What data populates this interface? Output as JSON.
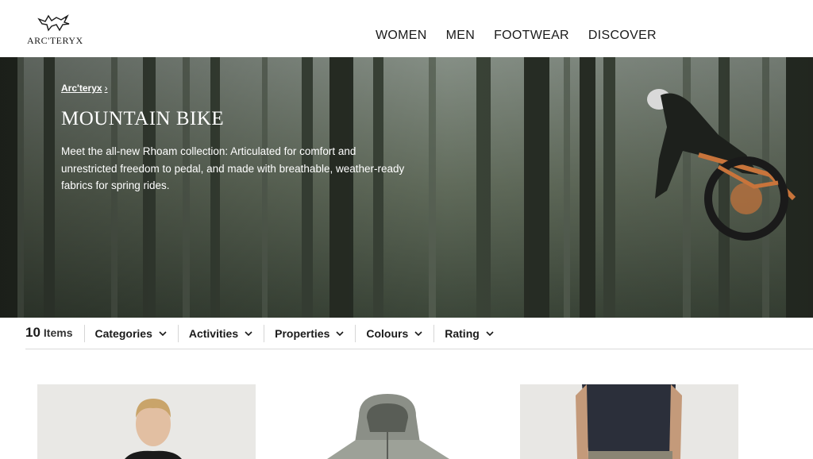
{
  "brand": {
    "name": "ARC'TERYX"
  },
  "nav": {
    "items": [
      "WOMEN",
      "MEN",
      "FOOTWEAR",
      "DISCOVER"
    ]
  },
  "hero": {
    "breadcrumb": "Arc'teryx",
    "title": "MOUNTAIN BIKE",
    "description": "Meet the all-new Rhoam collection: Articulated for comfort and unrestricted freedom to pedal, and made with breathable, weather-ready fabrics for spring rides."
  },
  "filters": {
    "count": "10",
    "count_label": "Items",
    "items": [
      "Categories",
      "Activities",
      "Properties",
      "Colours",
      "Rating"
    ]
  },
  "icons": {
    "chevron": "chevron-down-icon",
    "logo": "bird-logo-icon",
    "breadcrumb_sep": "chevron-right-icon"
  },
  "colors": {
    "text": "#1a1a1a",
    "hero_overlay": "#4a5649",
    "divider": "#d9d9d9"
  }
}
